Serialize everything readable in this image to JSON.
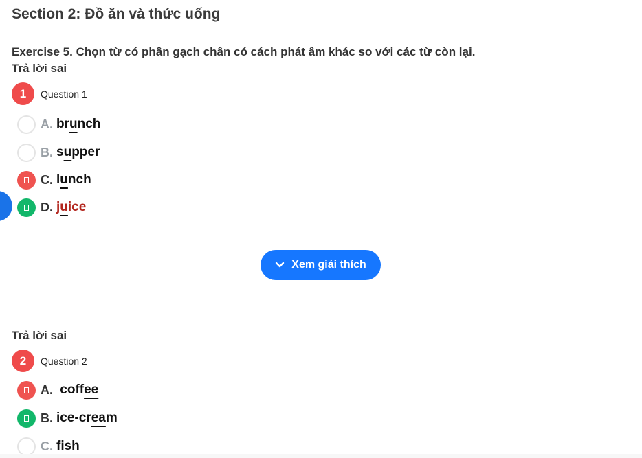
{
  "section": {
    "title": "Section 2: Đồ ăn và thức uống"
  },
  "exercise": {
    "title": "Exercise 5. Chọn từ có phần gạch chân có cách phát âm khác so với các từ còn lại."
  },
  "questions": [
    {
      "result": "Trả lời sai",
      "number": "1",
      "label": "Question 1",
      "options": [
        {
          "letter": "A.",
          "pre": "br",
          "u": "u",
          "post": "nch",
          "state": "unselected"
        },
        {
          "letter": "B.",
          "pre": "s",
          "u": "u",
          "post": "pper",
          "state": "unselected"
        },
        {
          "letter": "C.",
          "pre": "l",
          "u": "u",
          "post": "nch",
          "state": "wrong"
        },
        {
          "letter": "D.",
          "pre": "j",
          "u": "u",
          "post": "ice",
          "state": "correct"
        }
      ]
    },
    {
      "result": "Trả lời sai",
      "number": "2",
      "label": "Question 2",
      "options": [
        {
          "letter": "A.",
          "pre": " coff",
          "u": "ee",
          "post": "",
          "state": "wrong"
        },
        {
          "letter": "B.",
          "pre": "ice-cr",
          "u": "ea",
          "post": "m",
          "state": "correct"
        },
        {
          "letter": "C.",
          "pre": "f",
          "u": "i",
          "post": "sh",
          "state": "unselected"
        }
      ]
    }
  ],
  "explain_button": {
    "label": "Xem giải thích",
    "icon": "chevron-down-icon"
  },
  "colors": {
    "wrong": "#ef5350",
    "correct": "#12b76a",
    "primary": "#1677ff",
    "number_badge": "#ef4b4b"
  }
}
